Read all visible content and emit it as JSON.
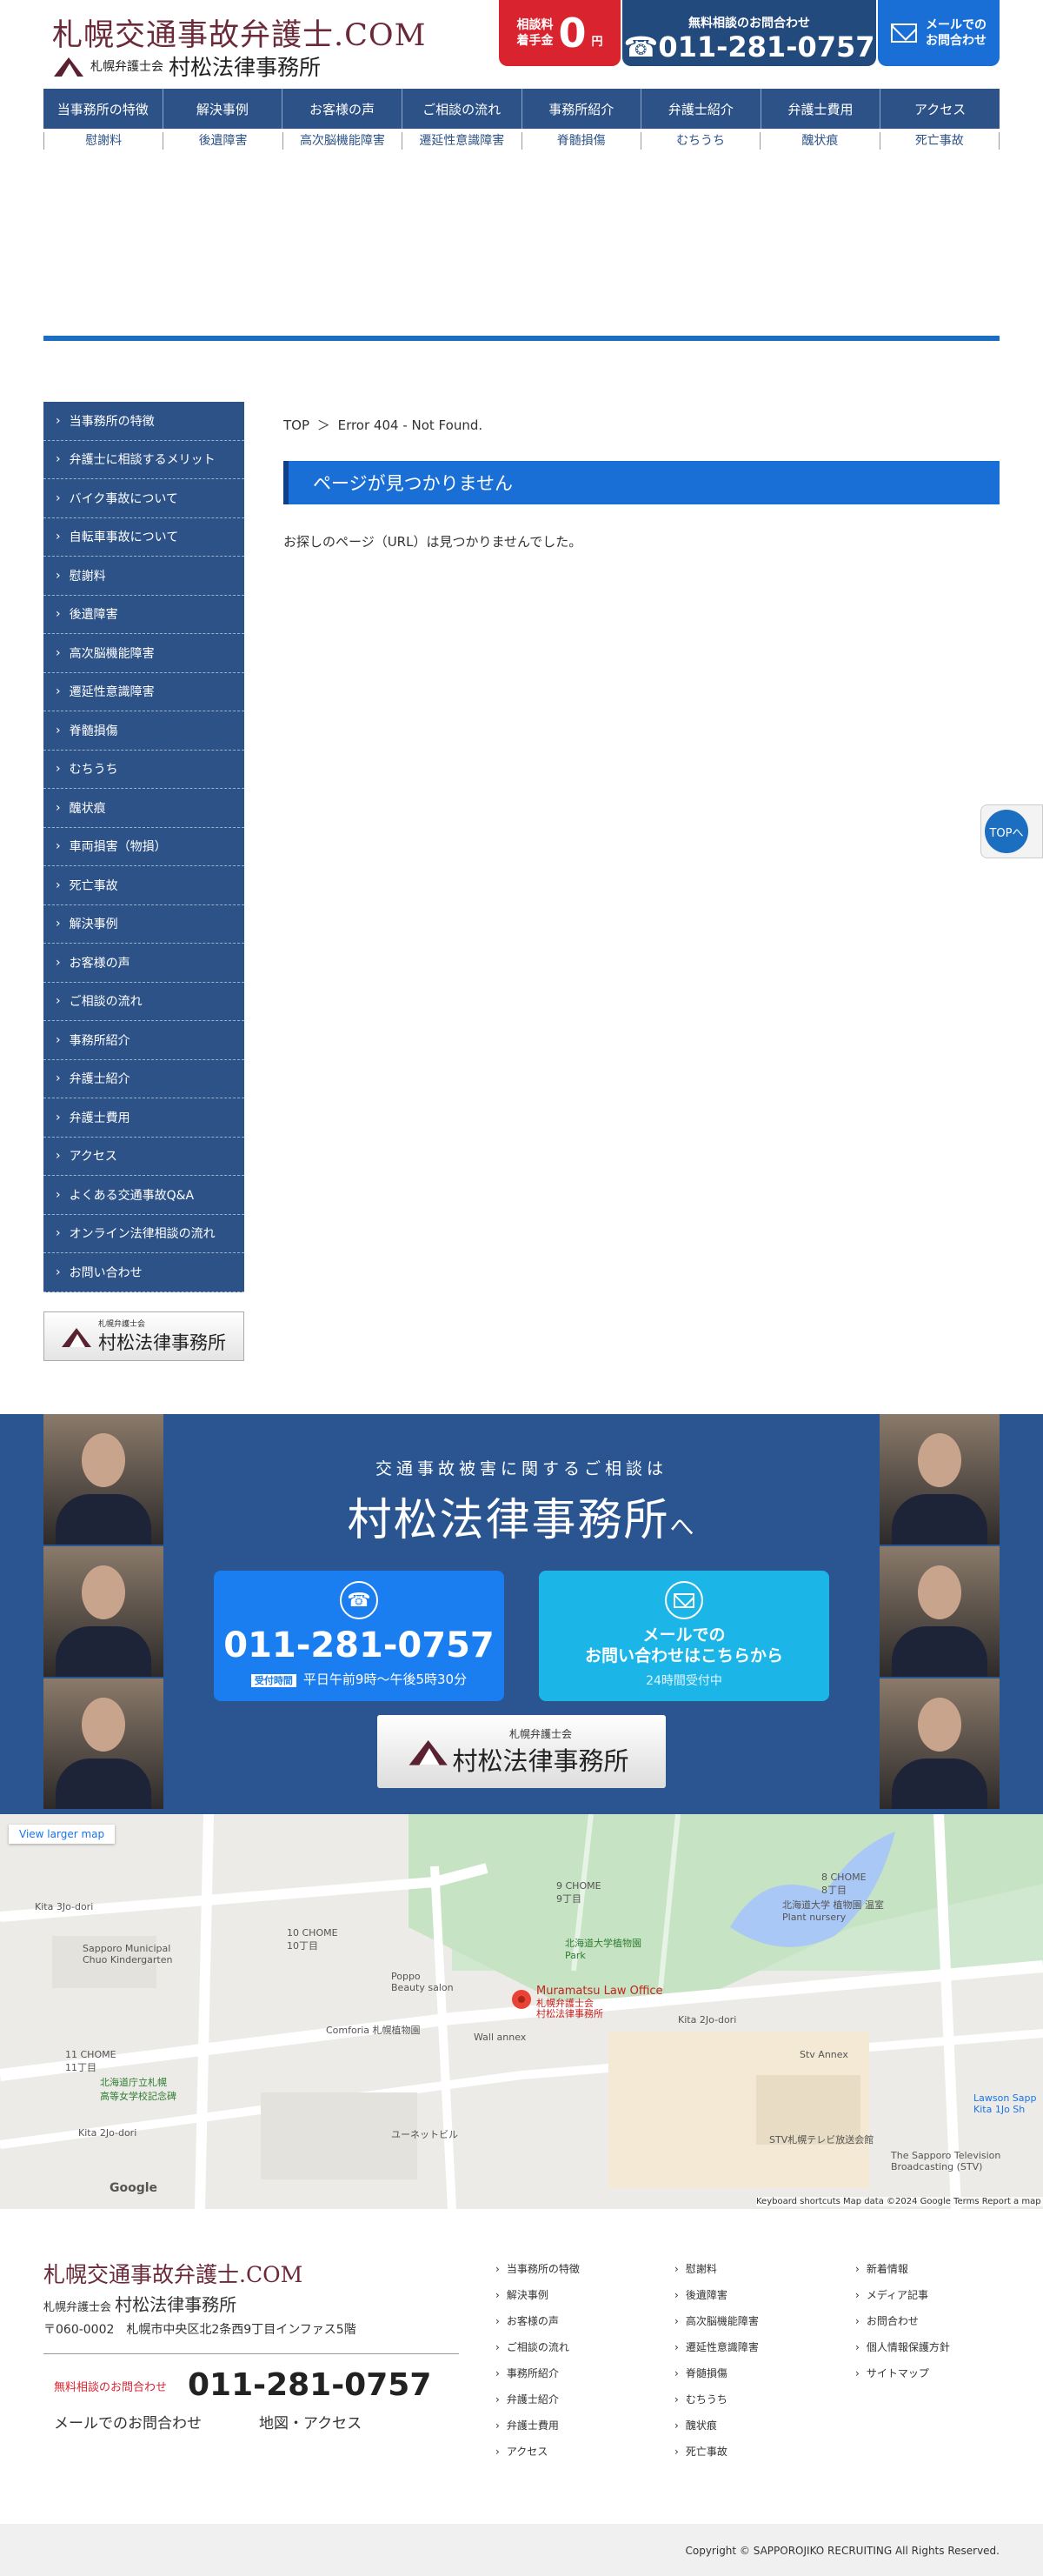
{
  "header": {
    "site_title": "札幌交通事故弁護士.COM",
    "assoc": "札幌弁護士会",
    "firm": "村松法律事務所",
    "fee_label": "相談料\n着手金",
    "fee_zero": "0",
    "fee_yen": "円",
    "tel_label": "無料相談のお問合わせ",
    "tel_number": "☎011-281-0757",
    "mail_label": "メールでの\nお問合わせ"
  },
  "nav": [
    "当事務所の特徴",
    "解決事例",
    "お客様の声",
    "ご相談の流れ",
    "事務所紹介",
    "弁護士紹介",
    "弁護士費用",
    "アクセス"
  ],
  "subnav": [
    "慰謝料",
    "後遺障害",
    "高次脳機能障害",
    "遷延性意識障害",
    "脊髄損傷",
    "むちうち",
    "醜状痕",
    "死亡事故"
  ],
  "sidebar": [
    "当事務所の特徴",
    "弁護士に相談するメリット",
    "バイク事故について",
    "自転車事故について",
    "慰謝料",
    "後遺障害",
    "高次脳機能障害",
    "遷延性意識障害",
    "脊髄損傷",
    "むちうち",
    "醜状痕",
    "車両損害（物損）",
    "死亡事故",
    "解決事例",
    "お客様の声",
    "ご相談の流れ",
    "事務所紹介",
    "弁護士紹介",
    "弁護士費用",
    "アクセス",
    "よくある交通事故Q&A",
    "オンライン法律相談の流れ",
    "お問い合わせ"
  ],
  "sidebar_logo": {
    "small": "札幌弁護士会",
    "big": "村松法律事務所"
  },
  "main": {
    "crumb_top": "TOP",
    "crumb_sep": "＞",
    "crumb_current": "Error 404 - Not Found.",
    "title": "ページが見つかりません",
    "text": "お探しのページ（URL）は見つかりませんでした。"
  },
  "totop": "TOPへ",
  "cta": {
    "lead": "交通事故被害に関するご相談は",
    "name": "村松法律事務所",
    "name_suffix": "へ",
    "tel": "011-281-0757",
    "hours_badge": "受付時間",
    "hours": "平日午前9時〜午後5時30分",
    "mail_line1": "メールでの",
    "mail_line2": "お問い合わせはこちらから",
    "mail_hours": "24時間受付中",
    "logo_small": "札幌弁護士会",
    "logo_big": "村松法律事務所"
  },
  "map": {
    "larger": "View larger map",
    "place": "Muramatsu Law Office",
    "place_sub": "札幌弁護士会\n村松法律事務所",
    "labels": [
      {
        "t": "Kita 3Jo-dori"
      },
      {
        "t": "Sapporo Municipal\nChuo Kindergarten"
      },
      {
        "t": "10 CHOME\n10丁目"
      },
      {
        "t": "9 CHOME\n9丁目"
      },
      {
        "t": "北海道大学 植物園 温室\nPlant nursery"
      },
      {
        "t": "8 CHOME\n8丁目"
      },
      {
        "t": "北海道大学植物園\nPark"
      },
      {
        "t": "Poppo\nBeauty salon"
      },
      {
        "t": "Comforia 札幌植物園"
      },
      {
        "t": "Wall annex"
      },
      {
        "t": "Kita 2Jo-dori"
      },
      {
        "t": "11 CHOME\n11丁目"
      },
      {
        "t": "北海道庁立札幌\n高等女学校記念碑"
      },
      {
        "t": "Kita 2Jo-dori"
      },
      {
        "t": "ユーネットビル"
      },
      {
        "t": "STV札幌テレビ放送会館"
      },
      {
        "t": "The Sapporo Television\nBroadcasting (STV)"
      },
      {
        "t": "Lawson Sapp\nKita 1Jo Sh"
      },
      {
        "t": "Stv Annex"
      }
    ],
    "google": "Google",
    "attribution": "Keyboard shortcuts   Map data ©2024 Google   Terms   Report a map error"
  },
  "footer": {
    "title": "札幌交通事故弁護士.COM",
    "assoc": "札幌弁護士会",
    "firm": "村松法律事務所",
    "address": "〒060-0002　札幌市中央区北2条西9丁目インファス5階",
    "tel_label": "無料相談のお問合わせ",
    "tel": "011-281-0757",
    "mail": "メールでのお問合わせ",
    "access": "地図・アクセス",
    "col1": [
      "当事務所の特徴",
      "解決事例",
      "お客様の声",
      "ご相談の流れ",
      "事務所紹介",
      "弁護士紹介",
      "弁護士費用",
      "アクセス"
    ],
    "col2": [
      "慰謝料",
      "後遺障害",
      "高次脳機能障害",
      "遷延性意識障害",
      "脊髄損傷",
      "むちうち",
      "醜状痕",
      "死亡事故"
    ],
    "col3": [
      "新着情報",
      "メディア記事",
      "お問合わせ",
      "個人情報保護方針",
      "サイトマップ"
    ],
    "copyright": "Copyright © SAPPOROJIKO RECRUITING All Rights Reserved."
  }
}
